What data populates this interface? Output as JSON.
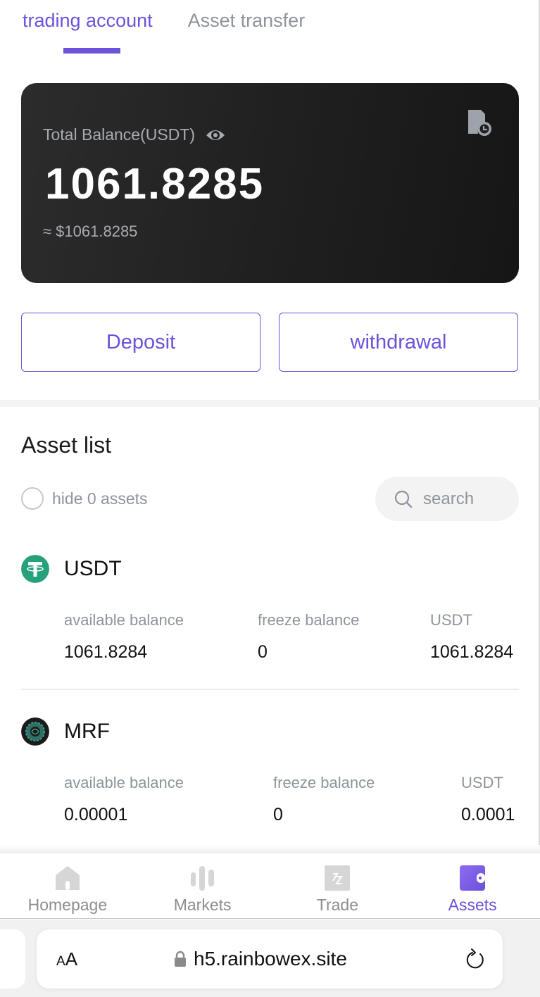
{
  "tabs": [
    {
      "label": "trading account",
      "active": true
    },
    {
      "label": "Asset transfer",
      "active": false
    }
  ],
  "balance_card": {
    "label": "Total Balance(USDT)",
    "amount": "1061.8285",
    "approx_usd": "≈ $1061.8285",
    "icons": [
      "eye-icon",
      "record-history-icon"
    ]
  },
  "actions": {
    "deposit_label": "Deposit",
    "withdrawal_label": "withdrawal"
  },
  "asset_list": {
    "title": "Asset list",
    "hide_zero_label": "hide 0 assets",
    "hide_zero_checked": false,
    "search_placeholder": "search",
    "columns": [
      "available balance",
      "freeze balance",
      "USDT"
    ],
    "assets": [
      {
        "symbol": "USDT",
        "icon": "tether-icon",
        "available": "1061.8284",
        "freeze": "0",
        "usdt_value": "1061.8284"
      },
      {
        "symbol": "MRF",
        "icon": "mrf-coin-icon",
        "available": "0.00001",
        "freeze": "0",
        "usdt_value": "0.0001"
      }
    ]
  },
  "bottom_nav": {
    "items": [
      {
        "label": "Homepage",
        "icon": "home-icon",
        "active": false
      },
      {
        "label": "Markets",
        "icon": "markets-icon",
        "active": false
      },
      {
        "label": "Trade",
        "icon": "trade-icon",
        "active": false
      },
      {
        "label": "Assets",
        "icon": "wallet-icon",
        "active": true
      }
    ]
  },
  "browser": {
    "text_size_label_small": "A",
    "text_size_label_large": "A",
    "url": "h5.rainbowex.site"
  },
  "colors": {
    "accent": "#6c52d9",
    "card_bg": "#1f1f1f",
    "muted_text": "#8e949c",
    "tether_green": "#26a17b"
  }
}
